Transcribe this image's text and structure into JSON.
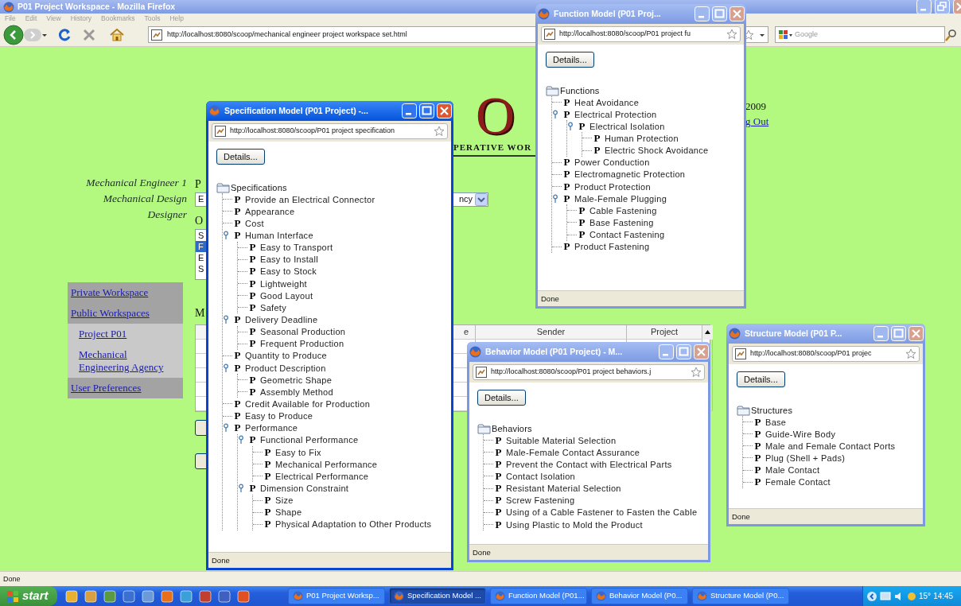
{
  "main_window": {
    "title": "P01 Project Workspace - Mozilla Firefox",
    "menu": [
      "File",
      "Edit",
      "View",
      "History",
      "Bookmarks",
      "Tools",
      "Help"
    ],
    "address": "http://localhost:8080/scoop/mechanical engineer project workspace set.html",
    "search": {
      "placeholder": "Google"
    },
    "status": "Done"
  },
  "page": {
    "logo": "O",
    "tagline": "PERATIVE WOR",
    "date": "2009",
    "logout": "g Out",
    "user_lines": [
      "Mechanical Engineer 1",
      "Mechanical Design",
      "Designer"
    ],
    "nav": [
      {
        "label": "Private Workspace",
        "kind": "section"
      },
      {
        "label": "Public Workspaces",
        "kind": "section"
      },
      {
        "label": "Project P01",
        "kind": "sub"
      },
      {
        "label": "Mechanical Engineering Agency",
        "kind": "sub"
      },
      {
        "label": "User Preferences",
        "kind": "section"
      }
    ],
    "label_1": "P",
    "select": {
      "value_start": "E",
      "value_end": "ncy"
    },
    "label_2": "O",
    "listbox": [
      {
        "text": "S",
        "selected": false
      },
      {
        "text": "F",
        "selected": true
      },
      {
        "text": "E",
        "selected": false
      },
      {
        "text": "S",
        "selected": false
      }
    ],
    "label_3": "M",
    "table": {
      "columns": [
        "e",
        "Sender",
        "Project"
      ]
    }
  },
  "popups": [
    {
      "title": "Specification Model (P01 Project) -...",
      "address": "http://localhost:8080/scoop/P01 project specification",
      "button": "Details...",
      "selected": true,
      "status": "Done",
      "tree": {
        "root": "Specifications",
        "items": [
          {
            "glyph": "P",
            "label": "Provide an Electrical Connector"
          },
          {
            "glyph": "P",
            "label": "Appearance"
          },
          {
            "glyph": "P",
            "label": "Cost"
          },
          {
            "glyph": "P",
            "label": "Human Interface",
            "expanded": true,
            "children": [
              {
                "glyph": "P",
                "label": "Easy to Transport"
              },
              {
                "glyph": "P",
                "label": "Easy to Install"
              },
              {
                "glyph": "P",
                "label": "Easy to Stock"
              },
              {
                "glyph": "P",
                "label": "Lightweight"
              },
              {
                "glyph": "P",
                "label": "Good Layout"
              },
              {
                "glyph": "P",
                "label": "Safety"
              }
            ]
          },
          {
            "glyph": "P",
            "label": "Delivery Deadline",
            "expanded": true,
            "children": [
              {
                "glyph": "P",
                "label": "Seasonal Production"
              },
              {
                "glyph": "P",
                "label": "Frequent Production"
              }
            ]
          },
          {
            "glyph": "P",
            "label": "Quantity to Produce"
          },
          {
            "glyph": "P",
            "label": "Product Description",
            "expanded": true,
            "children": [
              {
                "glyph": "P",
                "label": "Geometric Shape"
              },
              {
                "glyph": "P",
                "label": "Assembly Method"
              }
            ]
          },
          {
            "glyph": "P",
            "label": "Credit Available for Production"
          },
          {
            "glyph": "P",
            "label": "Easy to Produce"
          },
          {
            "glyph": "P",
            "label": "Performance",
            "expanded": true,
            "children": [
              {
                "glyph": "P",
                "label": "Functional Performance",
                "expanded": true,
                "children": [
                  {
                    "glyph": "P",
                    "label": "Easy to Fix"
                  },
                  {
                    "glyph": "P",
                    "label": "Mechanical Performance"
                  },
                  {
                    "glyph": "P",
                    "label": "Electrical Performance"
                  }
                ]
              },
              {
                "glyph": "P",
                "label": "Dimension Constraint",
                "expanded": true,
                "children": [
                  {
                    "glyph": "P",
                    "label": "Size"
                  },
                  {
                    "glyph": "P",
                    "label": "Shape"
                  },
                  {
                    "glyph": "P",
                    "label": "Physical Adaptation to Other Products"
                  }
                ]
              }
            ]
          }
        ]
      }
    },
    {
      "title": "Function Model (P01 Proj...",
      "address": "http://localhost:8080/scoop/P01 project fu",
      "button": "Details...",
      "selected": false,
      "status": "Done",
      "tree": {
        "root": "Functions",
        "items": [
          {
            "glyph": "P",
            "label": "Heat Avoidance"
          },
          {
            "glyph": "P",
            "label": "Electrical Protection",
            "expanded": true,
            "children": [
              {
                "glyph": "P",
                "label": "Electrical Isolation",
                "expanded": true,
                "children": [
                  {
                    "glyph": "P",
                    "label": "Human Protection"
                  },
                  {
                    "glyph": "P",
                    "label": "Electric Shock Avoidance"
                  }
                ]
              }
            ]
          },
          {
            "glyph": "P",
            "label": "Power Conduction"
          },
          {
            "glyph": "P",
            "label": "Electromagnetic Protection"
          },
          {
            "glyph": "P",
            "label": "Product Protection"
          },
          {
            "glyph": "P",
            "label": "Male-Female Plugging",
            "expanded": true,
            "children": [
              {
                "glyph": "P",
                "label": "Cable Fastening"
              },
              {
                "glyph": "P",
                "label": "Base Fastening"
              },
              {
                "glyph": "P",
                "label": "Contact Fastening"
              }
            ]
          },
          {
            "glyph": "P",
            "label": "Product Fastening"
          }
        ]
      }
    },
    {
      "title": "Behavior Model (P01 Project) - M...",
      "address": "http://localhost:8080/scoop/P01 project behaviors.j",
      "button": "Details...",
      "selected": false,
      "status": "Done",
      "tree": {
        "root": "Behaviors",
        "items": [
          {
            "glyph": "P",
            "label": "Suitable Material Selection"
          },
          {
            "glyph": "P",
            "label": "Male-Female Contact Assurance"
          },
          {
            "glyph": "P",
            "label": "Prevent the Contact with Electrical Parts"
          },
          {
            "glyph": "P",
            "label": "Contact Isolation"
          },
          {
            "glyph": "P",
            "label": "Resistant Material Selection"
          },
          {
            "glyph": "P",
            "label": "Screw Fastening"
          },
          {
            "glyph": "P",
            "label": "Using of a Cable Fastener to Fasten the Cable"
          },
          {
            "glyph": "P",
            "label": "Using Plastic to Mold the Product"
          }
        ]
      }
    },
    {
      "title": "Structure Model (P01 P...",
      "address": "http://localhost:8080/scoop/P01 projec",
      "button": "Details...",
      "selected": false,
      "status": "Done",
      "tree": {
        "root": "Structures",
        "items": [
          {
            "glyph": "P",
            "label": "Base"
          },
          {
            "glyph": "P",
            "label": "Guide-Wire Body"
          },
          {
            "glyph": "P",
            "label": "Male and Female Contact Ports"
          },
          {
            "glyph": "P",
            "label": "Plug (Shell + Pads)"
          },
          {
            "glyph": "P",
            "label": "Male Contact"
          },
          {
            "glyph": "P",
            "label": "Female Contact"
          }
        ]
      }
    }
  ],
  "taskbar": {
    "start": "start",
    "tasks": [
      {
        "label": "P01 Project Worksp...",
        "selected": false
      },
      {
        "label": "Specification Model ...",
        "selected": true
      },
      {
        "label": "Function Model (P01...",
        "selected": false
      },
      {
        "label": "Behavior Model (P0...",
        "selected": false
      },
      {
        "label": "Structure Model (P0...",
        "selected": false
      }
    ],
    "temperature": "15°",
    "clock": "14:45"
  }
}
